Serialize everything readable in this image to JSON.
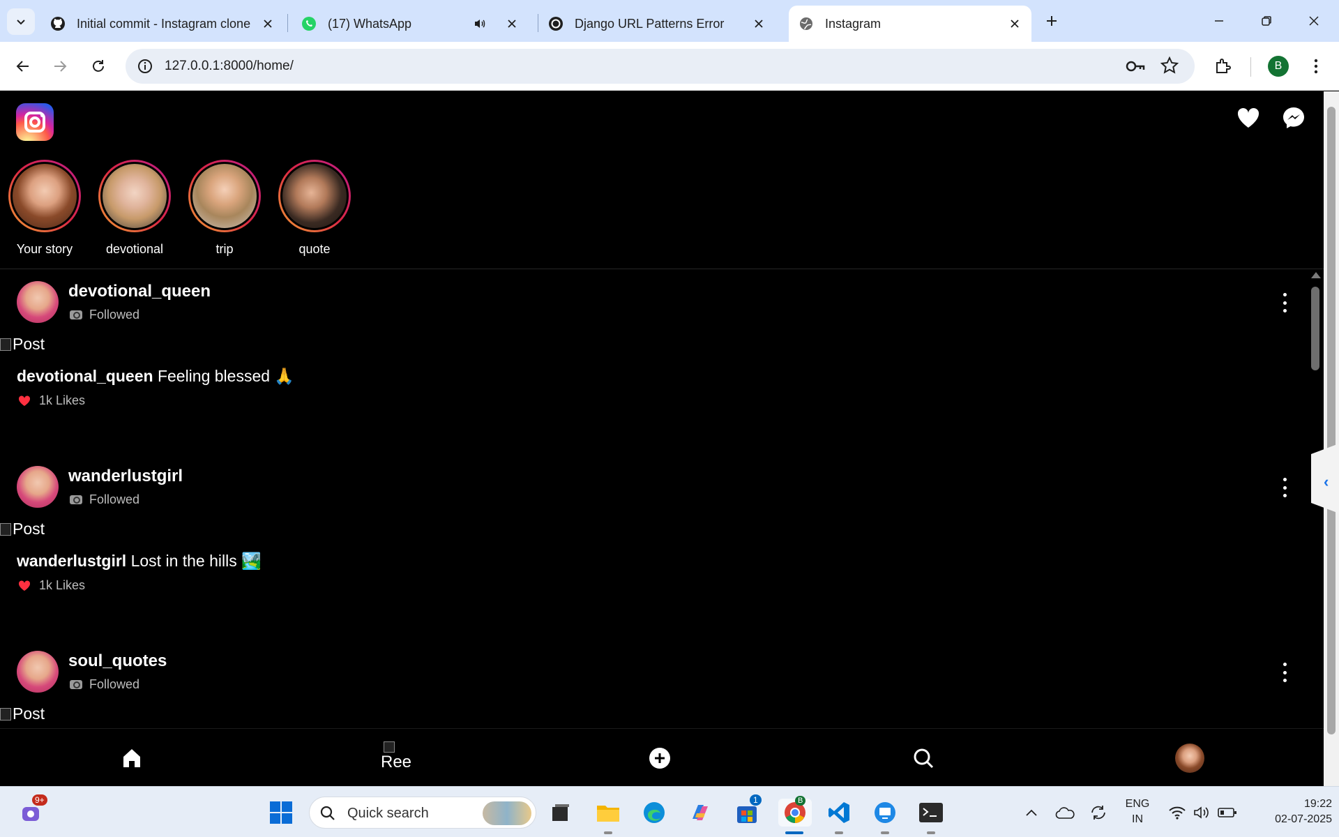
{
  "browser": {
    "tabs": [
      {
        "title": "Initial commit - Instagram clone",
        "icon": "github-icon"
      },
      {
        "title": "(17) WhatsApp",
        "icon": "whatsapp-icon"
      },
      {
        "title": "Django URL Patterns Error",
        "icon": "chatgpt-icon"
      },
      {
        "title": "Instagram",
        "icon": "globe-icon",
        "active": true
      }
    ],
    "url": "127.0.0.1:8000/home/",
    "profile_initial": "B"
  },
  "stories": [
    {
      "label": "Your story"
    },
    {
      "label": "devotional"
    },
    {
      "label": "trip"
    },
    {
      "label": "quote"
    }
  ],
  "posts": [
    {
      "username": "devotional_queen",
      "status": "Followed",
      "image_alt": "Post",
      "caption_user": "devotional_queen",
      "caption": "Feeling blessed 🙏",
      "likes": "1k Likes"
    },
    {
      "username": "wanderlustgirl",
      "status": "Followed",
      "image_alt": "Post",
      "caption_user": "wanderlustgirl",
      "caption": "Lost in the hills 🏞️",
      "likes": "1k Likes"
    },
    {
      "username": "soul_quotes",
      "status": "Followed",
      "image_alt": "Post"
    }
  ],
  "bottom_nav": {
    "reels_alt": "Ree"
  },
  "taskbar": {
    "chat_badge": "9+",
    "search_placeholder": "Quick search",
    "store_badge": "1",
    "chrome_badge": "B",
    "lang_line1": "ENG",
    "lang_line2": "IN",
    "time": "19:22",
    "date": "02-07-2025"
  },
  "colors": {
    "accent": "#1a73e8",
    "story_ring": "#dc2743",
    "likes_heart": "#ff3040"
  }
}
